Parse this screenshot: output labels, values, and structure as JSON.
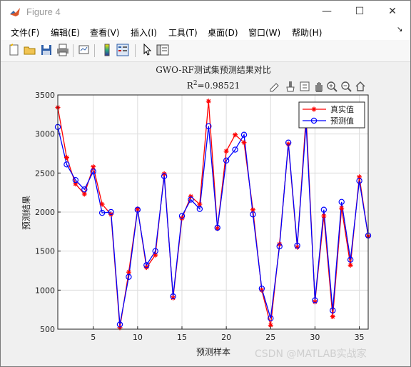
{
  "window": {
    "title": "Figure 4",
    "minimize": "—",
    "maximize": "☐",
    "close": "✕"
  },
  "menu": {
    "items": [
      "文件(F)",
      "编辑(E)",
      "查看(V)",
      "插入(I)",
      "工具(T)",
      "桌面(D)",
      "窗口(W)",
      "帮助(H)"
    ],
    "dock_arrow": "↘"
  },
  "toolbar": {
    "icons": [
      "new-figure-icon",
      "open-icon",
      "save-icon",
      "print-icon",
      "link-plot-icon",
      "colorbar-icon",
      "legend-icon",
      "pointer-icon",
      "property-editor-icon"
    ]
  },
  "axes_toolbar": {
    "icons": [
      "edit-plot-icon",
      "brush-icon",
      "data-tips-icon",
      "pan-icon",
      "zoom-in-icon",
      "zoom-out-icon",
      "restore-view-icon"
    ]
  },
  "watermark": "CSDN @MATLAB实战家",
  "colors": {
    "true_series": "#ff0000",
    "pred_series": "#0000ff",
    "grid": "#dcdcdc"
  },
  "chart_data": {
    "type": "line",
    "title": "GWO-RF测试集预测结果对比",
    "subtitle": "R²=0.98521",
    "xlabel": "预测样本",
    "ylabel": "预测结果",
    "xlim": [
      1,
      36
    ],
    "ylim": [
      500,
      3500
    ],
    "xticks": [
      5,
      10,
      15,
      20,
      25,
      30,
      35
    ],
    "yticks": [
      500,
      1000,
      1500,
      2000,
      2500,
      3000,
      3500
    ],
    "grid": true,
    "legend_position": "top-right",
    "x": [
      1,
      2,
      3,
      4,
      5,
      6,
      7,
      8,
      9,
      10,
      11,
      12,
      13,
      14,
      15,
      16,
      17,
      18,
      19,
      20,
      21,
      22,
      23,
      24,
      25,
      26,
      27,
      28,
      29,
      30,
      31,
      32,
      33,
      34,
      35,
      36
    ],
    "series": [
      {
        "name": "真实值",
        "marker": "star",
        "color": "#ff0000",
        "values": [
          3340,
          2700,
          2360,
          2230,
          2580,
          2100,
          1970,
          520,
          1230,
          2040,
          1290,
          1450,
          2490,
          900,
          1920,
          2200,
          2100,
          3420,
          1790,
          2780,
          2990,
          2890,
          2030,
          1000,
          550,
          1590,
          2870,
          1550,
          3230,
          850,
          1950,
          660,
          2050,
          1320,
          2450,
          1690
        ]
      },
      {
        "name": "预测值",
        "marker": "circle",
        "color": "#0000ff",
        "values": [
          3090,
          2610,
          2410,
          2290,
          2520,
          1990,
          2000,
          560,
          1170,
          2030,
          1320,
          1500,
          2460,
          920,
          1950,
          2160,
          2040,
          3100,
          1800,
          2660,
          2800,
          2990,
          1970,
          1020,
          640,
          1560,
          2890,
          1570,
          3130,
          870,
          2030,
          740,
          2130,
          1390,
          2400,
          1700
        ]
      }
    ]
  }
}
